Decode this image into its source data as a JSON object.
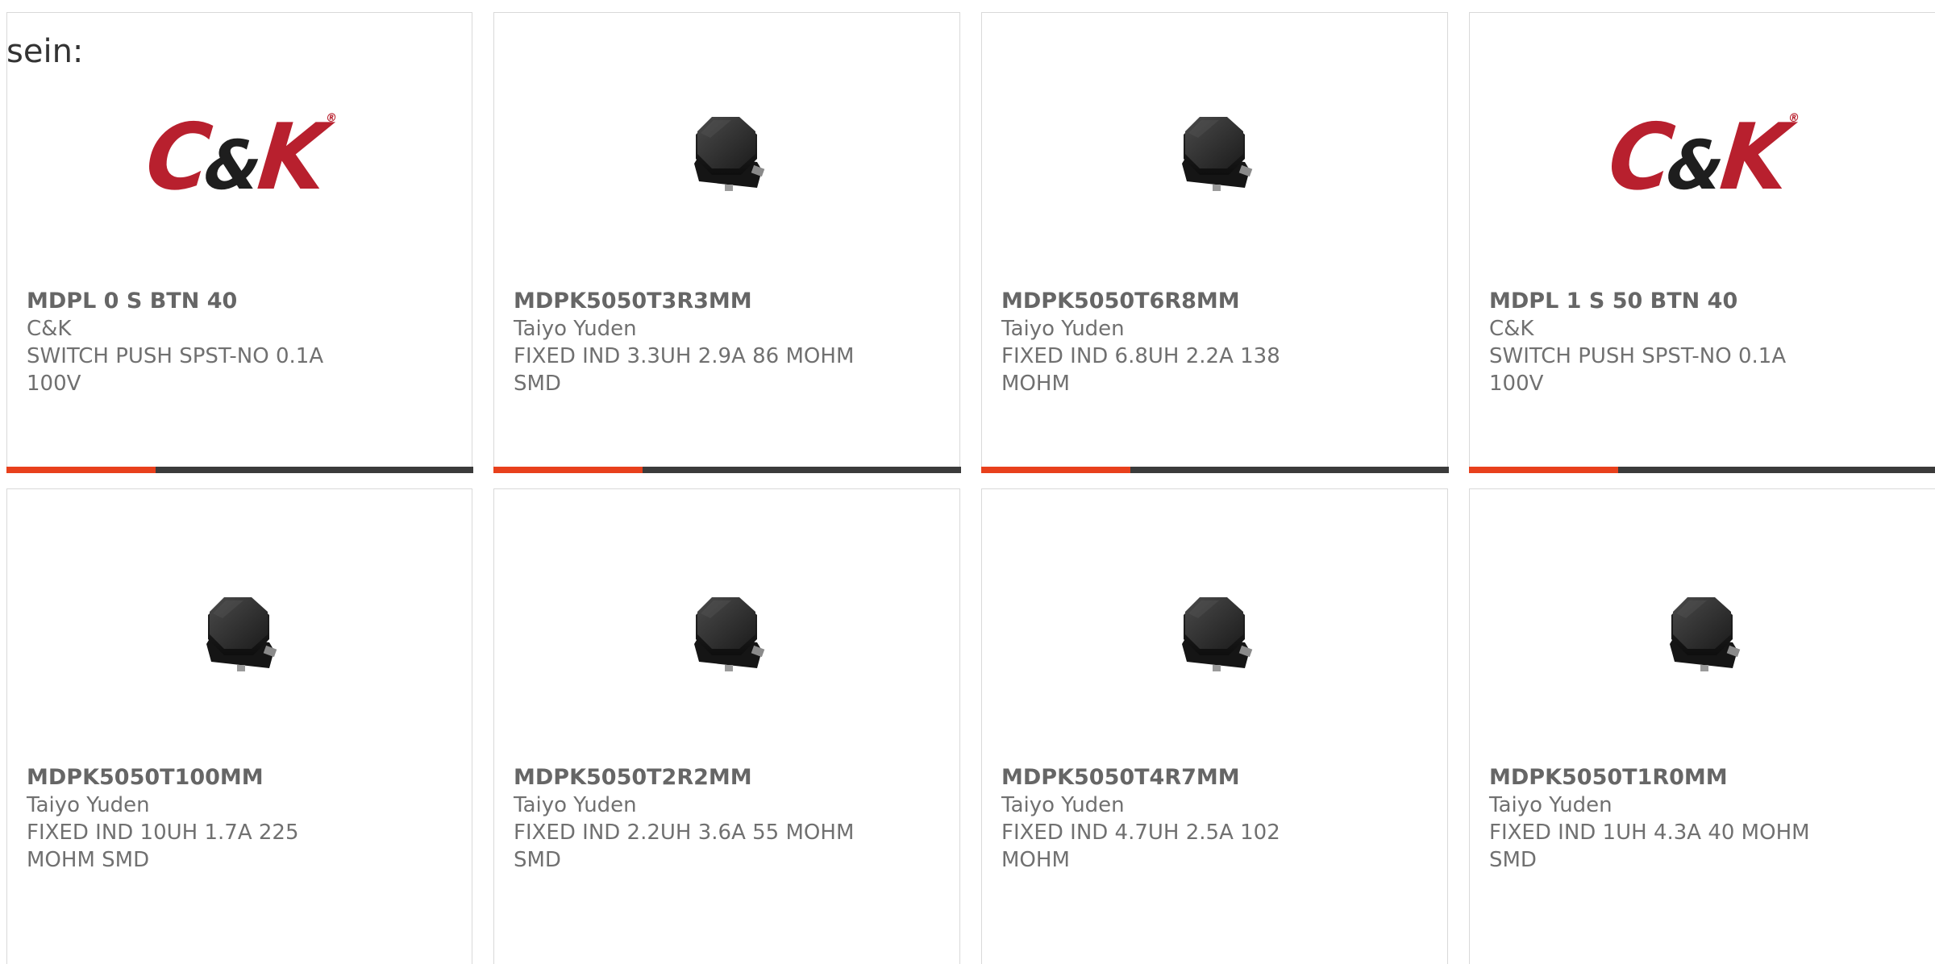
{
  "intro_text": "sein:",
  "colors": {
    "accent": "#e8401c",
    "bar_track": "#3b3b3b",
    "brand_red": "#b8202e",
    "text": "#707070"
  },
  "products": [
    {
      "part_number": "MDPL 0 S BTN 40",
      "manufacturer": "C&K",
      "description": "SWITCH PUSH SPST-NO 0.1A 100V",
      "image": "ck-logo",
      "logo_text": "C&K",
      "progress": 0.32
    },
    {
      "part_number": "MDPK5050T3R3MM",
      "manufacturer": "Taiyo Yuden",
      "description": "FIXED IND 3.3UH 2.9A 86 MOHM SMD",
      "image": "smd-inductor-icon",
      "progress": 0.32
    },
    {
      "part_number": "MDPK5050T6R8MM",
      "manufacturer": "Taiyo Yuden",
      "description": "FIXED IND 6.8UH 2.2A 138 MOHM",
      "image": "smd-inductor-icon",
      "progress": 0.32
    },
    {
      "part_number": "MDPL 1 S 50 BTN 40",
      "manufacturer": "C&K",
      "description": "SWITCH PUSH SPST-NO 0.1A 100V",
      "image": "ck-logo",
      "logo_text": "C&K",
      "progress": 0.32
    },
    {
      "part_number": "MDPK5050T100MM",
      "manufacturer": "Taiyo Yuden",
      "description": "FIXED IND 10UH 1.7A 225 MOHM SMD",
      "image": "smd-inductor-icon"
    },
    {
      "part_number": "MDPK5050T2R2MM",
      "manufacturer": "Taiyo Yuden",
      "description": "FIXED IND 2.2UH 3.6A 55 MOHM SMD",
      "image": "smd-inductor-icon"
    },
    {
      "part_number": "MDPK5050T4R7MM",
      "manufacturer": "Taiyo Yuden",
      "description": "FIXED IND 4.7UH 2.5A 102 MOHM",
      "image": "smd-inductor-icon"
    },
    {
      "part_number": "MDPK5050T1R0MM",
      "manufacturer": "Taiyo Yuden",
      "description": "FIXED IND 1UH 4.3A 40 MOHM SMD",
      "image": "smd-inductor-icon"
    }
  ]
}
